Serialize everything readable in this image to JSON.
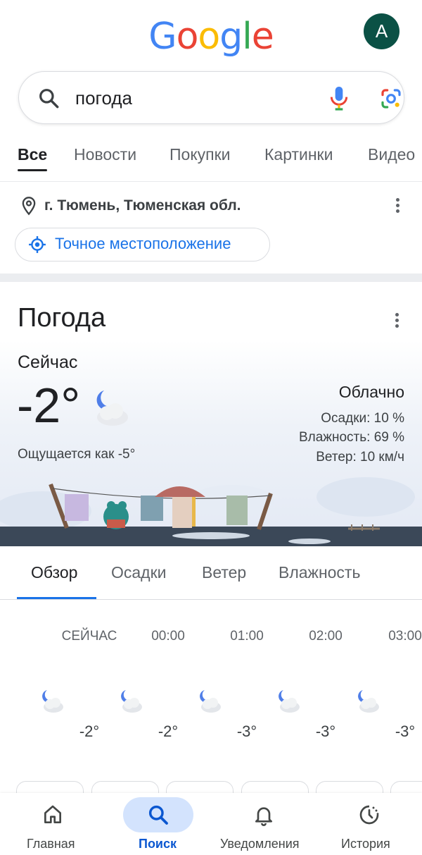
{
  "header": {
    "logo": [
      "G",
      "o",
      "o",
      "g",
      "l",
      "e"
    ],
    "logo_colors": [
      "#4285F4",
      "#EA4335",
      "#FBBC05",
      "#4285F4",
      "#34A853",
      "#EA4335"
    ],
    "avatar_initial": "A"
  },
  "search": {
    "query": "погода"
  },
  "tabs": [
    {
      "label": "Все",
      "active": true
    },
    {
      "label": "Новости"
    },
    {
      "label": "Покупки"
    },
    {
      "label": "Картинки"
    },
    {
      "label": "Видео"
    }
  ],
  "location": {
    "city": "г. Тюмень, Тюменская обл.",
    "precise_button": "Точное местоположение"
  },
  "weather": {
    "title": "Погода",
    "now_label": "Сейчас",
    "temperature": "-2°",
    "feels_like": "Ощущается как -5°",
    "condition": "Облачно",
    "precipitation": "Осадки: 10 %",
    "humidity": "Влажность: 69 %",
    "wind": "Ветер: 10 км/ч",
    "tabs": [
      "Обзор",
      "Осадки",
      "Ветер",
      "Влажность"
    ],
    "active_tab": "Обзор",
    "hourly": [
      {
        "time": "СЕЙЧАС",
        "temp": "-2°",
        "icon": "partly-cloudy-night-icon"
      },
      {
        "time": "00:00",
        "temp": "-2°",
        "icon": "partly-cloudy-night-icon"
      },
      {
        "time": "01:00",
        "temp": "-3°",
        "icon": "partly-cloudy-night-icon"
      },
      {
        "time": "02:00",
        "temp": "-3°",
        "icon": "partly-cloudy-night-icon"
      },
      {
        "time": "03:00",
        "temp": "-3°",
        "icon": "partly-cloudy-night-icon"
      }
    ]
  },
  "bottom_nav": [
    {
      "label": "Главная",
      "icon": "home-icon"
    },
    {
      "label": "Поиск",
      "icon": "search-icon",
      "active": true
    },
    {
      "label": "Уведомления",
      "icon": "bell-icon"
    },
    {
      "label": "История",
      "icon": "history-icon"
    }
  ],
  "colors": {
    "accent": "#1a73e8",
    "avatar": "#0b5145",
    "active_nav_pill": "#d3e3fd"
  }
}
